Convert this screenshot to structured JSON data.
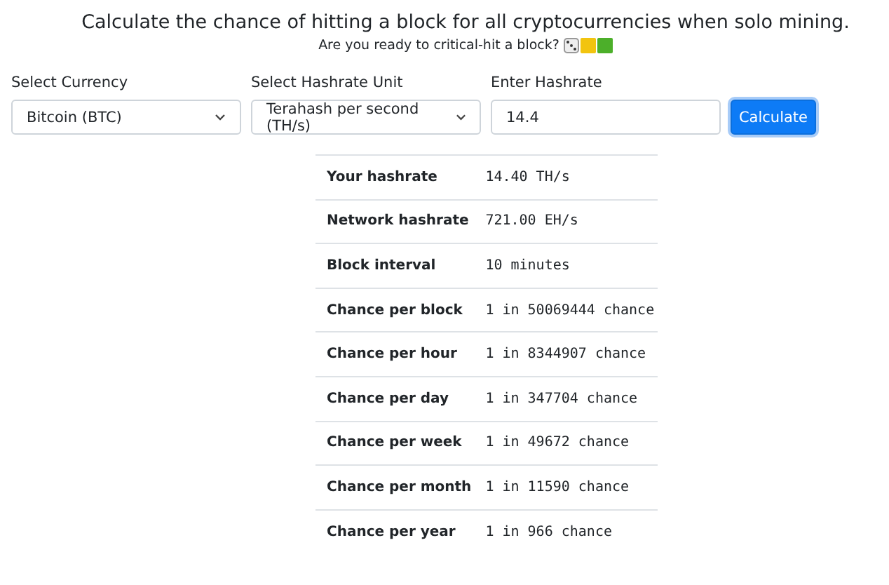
{
  "title": "Calculate the chance of hitting a block for all cryptocurrencies when solo mining.",
  "subtitle": "Are you ready to critical-hit a block?",
  "fields": [
    {
      "label": "Select Currency",
      "kind": "select",
      "value": "Bitcoin (BTC)"
    },
    {
      "label": "Select Hashrate Unit",
      "kind": "select",
      "value": "Terahash per second (TH/s)"
    },
    {
      "label": "Enter Hashrate",
      "kind": "input",
      "value": "14.4"
    }
  ],
  "button": "Calculate",
  "results": [
    {
      "label": "Your hashrate",
      "value": "14.40 TH/s"
    },
    {
      "label": "Network hashrate",
      "value": "721.00 EH/s"
    },
    {
      "label": "Block interval",
      "value": "10 minutes"
    },
    {
      "label": "Chance per block",
      "value": "1 in 50069444 chance"
    },
    {
      "label": "Chance per hour",
      "value": "1 in 8344907 chance"
    },
    {
      "label": "Chance per day",
      "value": "1 in 347704 chance"
    },
    {
      "label": "Chance per week",
      "value": "1 in 49672 chance"
    },
    {
      "label": "Chance per month",
      "value": "1 in 11590 chance"
    },
    {
      "label": "Chance per year",
      "value": "1 in 966 chance"
    }
  ]
}
